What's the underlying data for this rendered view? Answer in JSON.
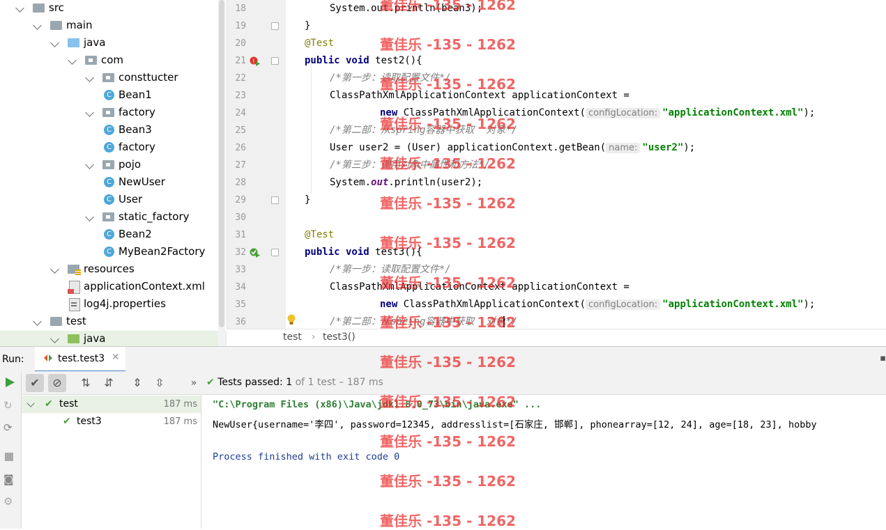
{
  "project_tree": [
    {
      "label": "src",
      "depth": 0,
      "kind": "folder",
      "open": true
    },
    {
      "label": "main",
      "depth": 1,
      "kind": "folder",
      "open": true
    },
    {
      "label": "java",
      "depth": 2,
      "kind": "folder-blue",
      "open": true
    },
    {
      "label": "com",
      "depth": 3,
      "kind": "package",
      "open": true
    },
    {
      "label": "consttucter",
      "depth": 4,
      "kind": "package",
      "open": true
    },
    {
      "label": "Bean1",
      "depth": 5,
      "kind": "class",
      "open": null
    },
    {
      "label": "factory",
      "depth": 4,
      "kind": "package",
      "open": true
    },
    {
      "label": "Bean3",
      "depth": 5,
      "kind": "class",
      "open": null
    },
    {
      "label": "factory",
      "depth": 5,
      "kind": "class",
      "open": null
    },
    {
      "label": "pojo",
      "depth": 4,
      "kind": "package",
      "open": true
    },
    {
      "label": "NewUser",
      "depth": 5,
      "kind": "class",
      "open": null
    },
    {
      "label": "User",
      "depth": 5,
      "kind": "class",
      "open": null
    },
    {
      "label": "static_factory",
      "depth": 4,
      "kind": "package",
      "open": true
    },
    {
      "label": "Bean2",
      "depth": 5,
      "kind": "class",
      "open": null
    },
    {
      "label": "MyBean2Factory",
      "depth": 5,
      "kind": "class",
      "open": null
    },
    {
      "label": "resources",
      "depth": 2,
      "kind": "resources",
      "open": true
    },
    {
      "label": "applicationContext.xml",
      "depth": 3,
      "kind": "xml",
      "open": null
    },
    {
      "label": "log4j.properties",
      "depth": 3,
      "kind": "properties",
      "open": null
    },
    {
      "label": "test",
      "depth": 1,
      "kind": "folder",
      "open": true
    },
    {
      "label": "java",
      "depth": 2,
      "kind": "folder-green",
      "open": true
    }
  ],
  "editor": {
    "line_numbers": [
      "18",
      "19",
      "20",
      "21",
      "22",
      "23",
      "24",
      "25",
      "26",
      "27",
      "28",
      "29",
      "30",
      "31",
      "32",
      "33",
      "34",
      "35",
      "36"
    ],
    "lines": {
      "l18": "System.out.println(bean3);",
      "l19": "}",
      "l20": "@Test",
      "l21_kw": "public void",
      "l21": " test2(){",
      "l22": "/*第一步：读取配置文件*/",
      "l23": "ClassPathXmlApplicationContext applicationContext =",
      "l24_new": "new",
      "l24_cls": " ClassPathXmlApplicationContext(",
      "l24_hint": "configLocation:",
      "l24_str": "\"applicationContext.xml\"",
      "l24_end": ");",
      "l25": "/*第二部：从spring容器中获取  对象*/",
      "l26_a": "User user2 = (User) applicationContext.getBean(",
      "l26_hint": "name:",
      "l26_str": "\"user2\"",
      "l26_end": ");",
      "l27": "/*第三步：调用对象中属性和方法*/",
      "l28_a": "System.",
      "l28_out": "out",
      "l28_b": ".println(user2);",
      "l29": "}",
      "l31": "@Test",
      "l32_kw": "public void",
      "l32": " test3(){",
      "l33": "/*第一步：读取配置文件*/",
      "l34": "ClassPathXmlApplicationContext applicationContext =",
      "l35_new": "new",
      "l35_cls": " ClassPathXmlApplicationContext(",
      "l35_hint": "configLocation:",
      "l35_str": "\"applicationContext.xml\"",
      "l35_end": ");",
      "l36": "/*第二部：从spring容器中获取  对象*/"
    },
    "breadcrumb": [
      "test",
      "test3()"
    ]
  },
  "run_panel": {
    "label": "Run:",
    "tab_title": "test.test3",
    "status_prefix": "Tests passed:",
    "status_count": "1",
    "status_rest": "of 1 test – 187 ms",
    "more": "»",
    "tests": [
      {
        "name": "test",
        "time": "187 ms"
      },
      {
        "name": "test3",
        "time": "187 ms"
      }
    ],
    "console": [
      "\"C:\\Program Files (x86)\\Java\\jdk1.8.0_73\\bin\\java.exe\" ...",
      "NewUser{username='李四', password=12345, addresslist=[石家庄, 邯郸], phonearray=[12, 24], age=[18, 23], hobby",
      "",
      "Process finished with exit code 0"
    ]
  },
  "watermark": "董佳乐 -135 - 1262",
  "colors": {
    "keyword": "#000080",
    "string": "#008000",
    "comment": "#808080",
    "annotation": "#808000",
    "pass": "#4b9e3c",
    "console_cmd": "#2e7d32",
    "console_exit": "#1c3d91"
  }
}
